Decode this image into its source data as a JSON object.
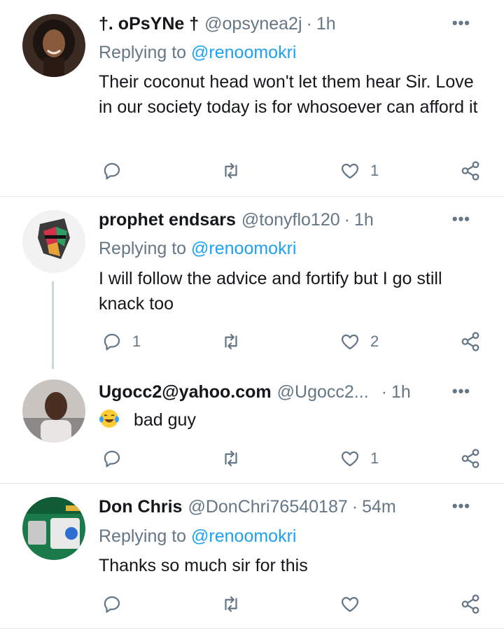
{
  "tweets": [
    {
      "name": "†. oPsYNe †",
      "handle": "@opsynea2j",
      "time": "1h",
      "replying_prefix": "Replying to ",
      "replying_to": "@renoomokri",
      "text": "Their coconut head  won't let them  hear Sir. Love in our society today is for whosoever can afford it",
      "reply_count": "",
      "retweet_count": "",
      "like_count": "1"
    },
    {
      "name": "prophet endsars",
      "handle": "@tonyflo120",
      "time": "1h",
      "replying_prefix": "Replying to ",
      "replying_to": "@renoomokri",
      "text": "I will follow the advice and fortify but I go still knack too",
      "reply_count": "1",
      "retweet_count": "",
      "like_count": "2"
    },
    {
      "name": "Ugocc2@yahoo.com",
      "handle": "@Ugocc2...",
      "time": "1h",
      "emoji": "laughing-with-tears-emoji",
      "text": "bad guy",
      "reply_count": "",
      "retweet_count": "",
      "like_count": "1"
    },
    {
      "name": "Don Chris",
      "handle": "@DonChri76540187",
      "time": "54m",
      "replying_prefix": "Replying to ",
      "replying_to": "@renoomokri",
      "text": "Thanks so much sir for this",
      "reply_count": "",
      "retweet_count": "",
      "like_count": ""
    }
  ],
  "more_label": "•••",
  "dot_separator": "·",
  "colors": {
    "mention": "#1da1f2",
    "secondary": "#657786",
    "divider": "#e1e8ed",
    "thread_line": "#ccd6dd"
  },
  "icons": [
    "reply-icon",
    "retweet-icon",
    "like-icon",
    "share-icon",
    "more-icon"
  ]
}
